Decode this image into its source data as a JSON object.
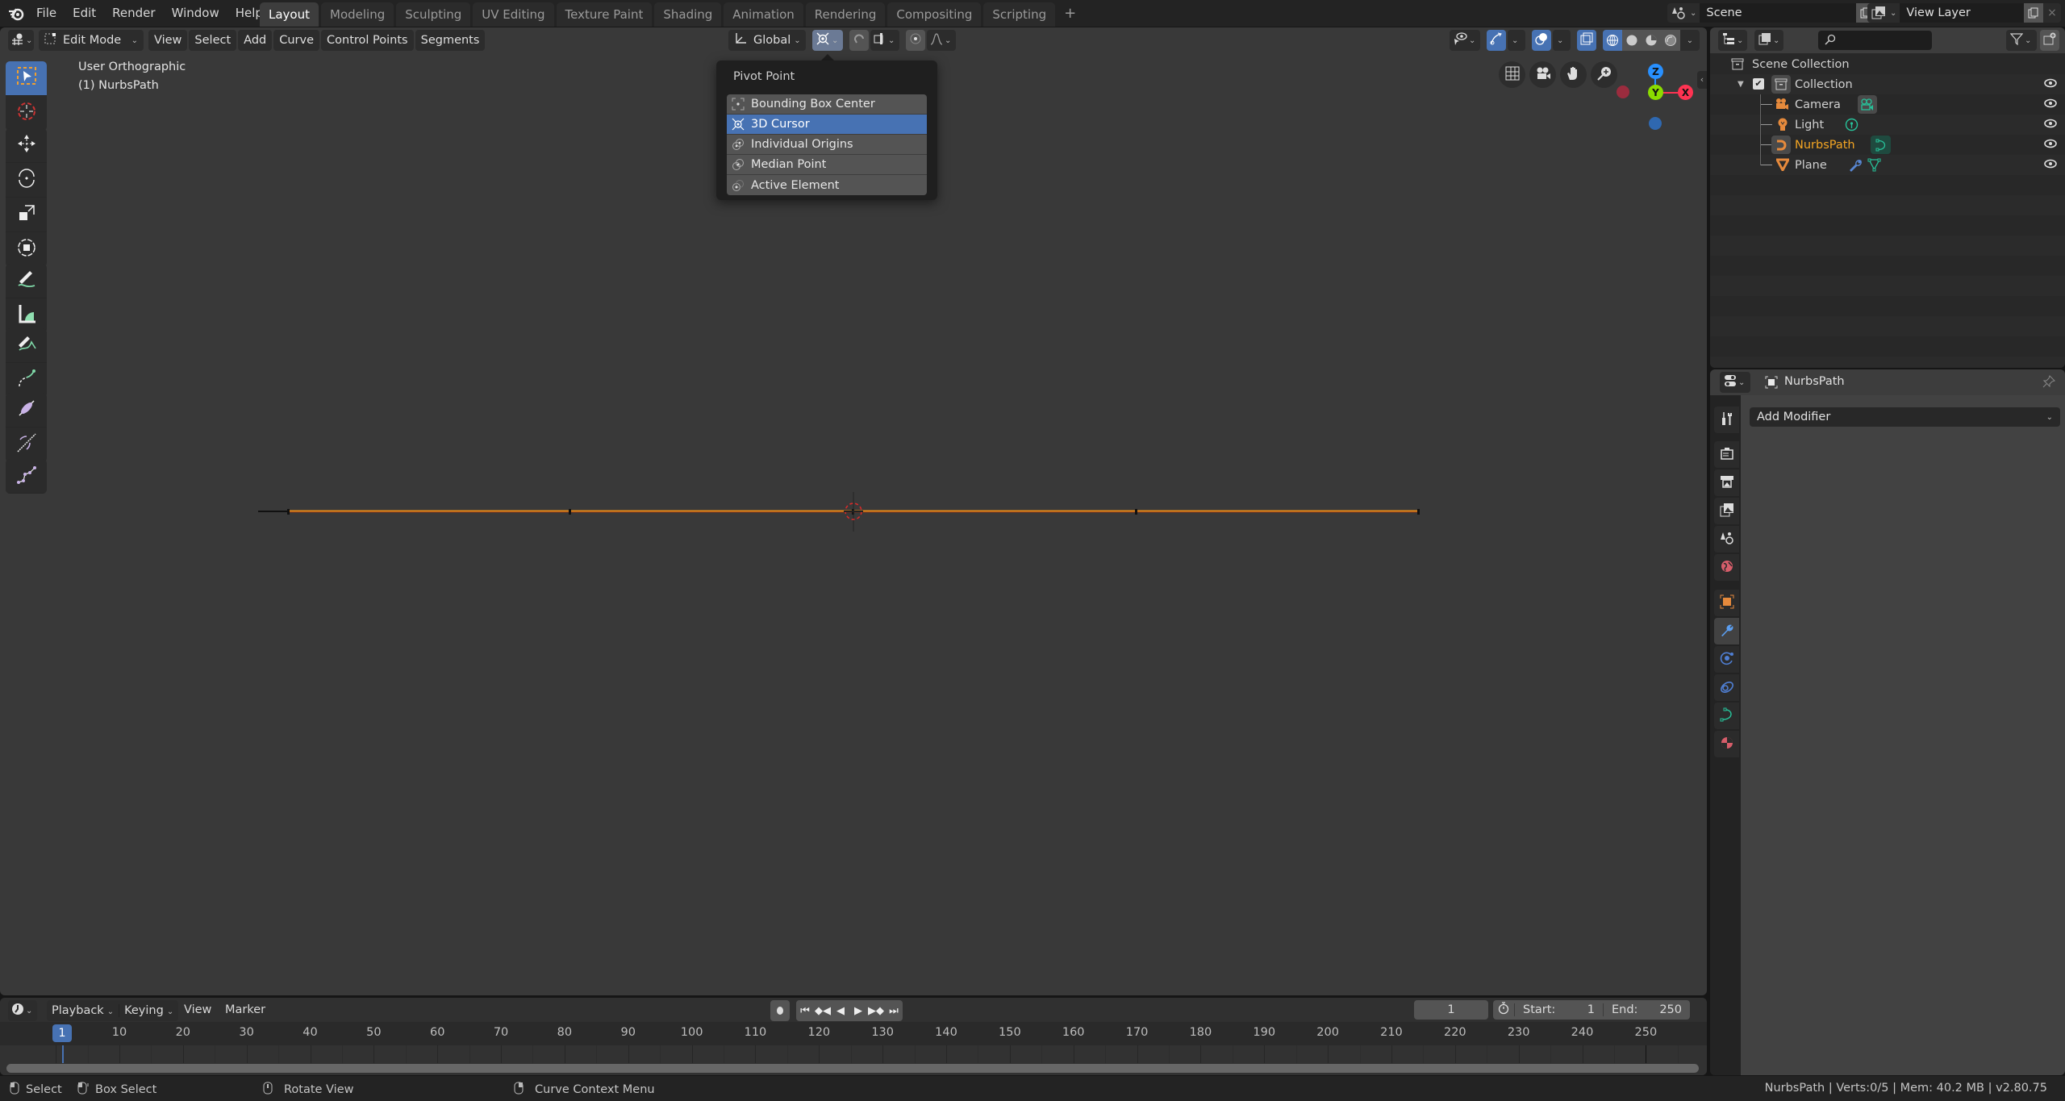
{
  "topbar": {
    "app_icon": "blender-logo-icon",
    "menus": [
      "File",
      "Edit",
      "Render",
      "Window",
      "Help"
    ],
    "workspace_tabs": [
      {
        "label": "Layout",
        "active": true
      },
      {
        "label": "Modeling",
        "active": false
      },
      {
        "label": "Sculpting",
        "active": false
      },
      {
        "label": "UV Editing",
        "active": false
      },
      {
        "label": "Texture Paint",
        "active": false
      },
      {
        "label": "Shading",
        "active": false
      },
      {
        "label": "Animation",
        "active": false
      },
      {
        "label": "Rendering",
        "active": false
      },
      {
        "label": "Compositing",
        "active": false
      },
      {
        "label": "Scripting",
        "active": false
      }
    ],
    "add_workspace": "+",
    "scene": {
      "icon": "scene-icon",
      "value": "Scene",
      "copy_icon": "copy-icon",
      "close": "×"
    },
    "view_layer": {
      "icon": "view-layer-icon",
      "value": "View Layer",
      "copy_icon": "copy-icon",
      "close": "×"
    }
  },
  "viewport": {
    "header": {
      "editor_type_icon": "3d-viewport-icon",
      "mode": "Edit Mode",
      "menus": [
        "View",
        "Select",
        "Add",
        "Curve",
        "Control Points",
        "Segments"
      ],
      "transform_orientation": "Global",
      "pivot_icon": "pivot-3d-cursor-icon",
      "snap_icon": "snap-magnet-icon",
      "proportional_icon": "proportional-edit-icon"
    },
    "overlay_text": {
      "view_name": "User Orthographic",
      "object_name": "(1) NurbsPath"
    },
    "nav_gizmo": {
      "axes": [
        "Z",
        "Y",
        "X"
      ],
      "colors": {
        "x": "#ff3352",
        "y": "#8bdc00",
        "z": "#2890ff"
      }
    },
    "curve_color": "#e38a1a"
  },
  "pivot_menu": {
    "title": "Pivot Point",
    "items": [
      {
        "label": "Bounding Box Center",
        "icon": "bounding-box-center-icon",
        "selected": false
      },
      {
        "label": "3D Cursor",
        "icon": "3d-cursor-icon",
        "selected": true
      },
      {
        "label": "Individual Origins",
        "icon": "individual-origins-icon",
        "selected": false
      },
      {
        "label": "Median Point",
        "icon": "median-point-icon",
        "selected": false
      },
      {
        "label": "Active Element",
        "icon": "active-element-icon",
        "selected": false
      }
    ]
  },
  "outliner": {
    "search_placeholder": "",
    "rows": [
      {
        "label": "Scene Collection",
        "icon": "scene-collection-icon",
        "level": 0
      },
      {
        "label": "Collection",
        "icon": "collection-icon",
        "level": 1,
        "checked": true,
        "expanded": true
      },
      {
        "label": "Camera",
        "icon": "camera-object-icon",
        "data_icon": "camera-data-icon",
        "level": 2
      },
      {
        "label": "Light",
        "icon": "light-object-icon",
        "data_icon": "light-data-icon",
        "level": 2
      },
      {
        "label": "NurbsPath",
        "icon": "curve-object-icon",
        "data_icon": "curve-data-icon",
        "level": 2,
        "active": true
      },
      {
        "label": "Plane",
        "icon": "mesh-object-icon",
        "modifier_icon": "wrench-icon",
        "data_icon": "mesh-data-icon",
        "level": 2
      }
    ]
  },
  "properties": {
    "object_name": "NurbsPath",
    "add_modifier": "Add Modifier",
    "tabs": [
      "tool",
      "render",
      "output",
      "view-layer",
      "scene",
      "world",
      "object",
      "modifiers",
      "physics",
      "constraints",
      "data",
      "material"
    ],
    "active_tab": "modifiers"
  },
  "timeline": {
    "menus": [
      "Playback",
      "Keying",
      "View",
      "Marker"
    ],
    "current_frame": "1",
    "start_label": "Start:",
    "start": "1",
    "end_label": "End:",
    "end": "250",
    "ruler_ticks": [
      "10",
      "20",
      "30",
      "40",
      "50",
      "60",
      "70",
      "80",
      "90",
      "100",
      "110",
      "120",
      "130",
      "140",
      "150",
      "160",
      "170",
      "180",
      "190",
      "200",
      "210",
      "220",
      "230",
      "240",
      "250"
    ],
    "playhead": "1"
  },
  "statusbar": {
    "hints": [
      {
        "icon": "mouse-left-icon",
        "label": "Select"
      },
      {
        "icon": "mouse-drag-icon",
        "label": "Box Select"
      },
      {
        "icon": "mouse-middle-icon",
        "label": "Rotate View"
      },
      {
        "icon": "mouse-right-icon",
        "label": "Curve Context Menu"
      }
    ],
    "info": "NurbsPath | Verts:0/5 | Mem: 40.2 MB | v2.80.75"
  }
}
